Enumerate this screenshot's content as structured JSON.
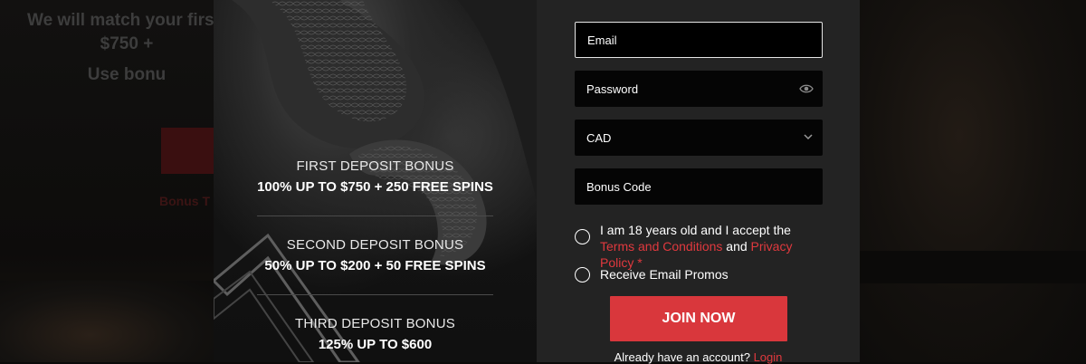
{
  "background": {
    "line1": "We will match your first",
    "line2": "$750 +",
    "line3": "Use bonu",
    "link": "Bonus T"
  },
  "promo": {
    "bonuses": [
      {
        "title": "FIRST DEPOSIT BONUS",
        "amount": "100% UP TO $750 + 250 FREE SPINS"
      },
      {
        "title": "SECOND DEPOSIT BONUS",
        "amount": "50% UP TO $200 + 50 FREE SPINS"
      },
      {
        "title": "THIRD DEPOSIT BONUS",
        "amount": "125% UP TO $600"
      }
    ]
  },
  "form": {
    "email_placeholder": "Email",
    "password_placeholder": "Password",
    "currency": "CAD",
    "bonus_code_placeholder": "Bonus Code",
    "terms": {
      "prefix": "I am 18 years old and I accept the ",
      "terms_link": "Terms and Conditions",
      "and": " and ",
      "privacy_link": "Privacy Policy",
      "required": " *"
    },
    "email_promos": "Receive Email Promos",
    "join_label": "JOIN NOW",
    "login_prompt": "Already have an account? ",
    "login_link": "Login"
  },
  "icons": {
    "password": "eye-icon",
    "currency": "chevron-down-icon"
  },
  "colors": {
    "accent": "#d9373c",
    "link": "#e0393e",
    "panel": "#232323",
    "field": "#050505"
  }
}
